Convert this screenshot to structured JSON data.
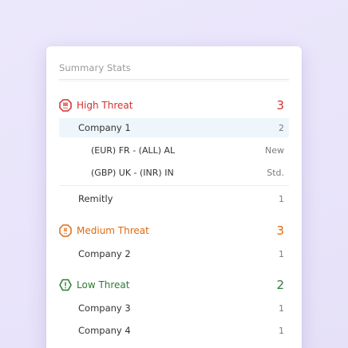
{
  "card": {
    "title": "Summary Stats"
  },
  "groups": {
    "high": {
      "label": "High Threat",
      "count": "3",
      "icon": "octagon-exclamation-icon",
      "color": "#d32f2f",
      "items": [
        {
          "name": "Company 1",
          "count": "2"
        },
        {
          "name": "(EUR) FR - (ALL) AL",
          "count": "New"
        },
        {
          "name": "(GBP) UK - (INR) IN",
          "count": "Std."
        },
        {
          "name": "Remitly",
          "count": "1"
        }
      ]
    },
    "medium": {
      "label": "Medium Threat",
      "count": "3",
      "icon": "octagon-exclamation-icon",
      "color": "#e06a10",
      "items": [
        {
          "name": "Company 2",
          "count": "1"
        }
      ]
    },
    "low": {
      "label": "Low Threat",
      "count": "2",
      "icon": "hexagon-exclamation-icon",
      "color": "#2e7d32",
      "items": [
        {
          "name": "Company 3",
          "count": "1"
        },
        {
          "name": "Company 4",
          "count": "1"
        }
      ]
    }
  }
}
